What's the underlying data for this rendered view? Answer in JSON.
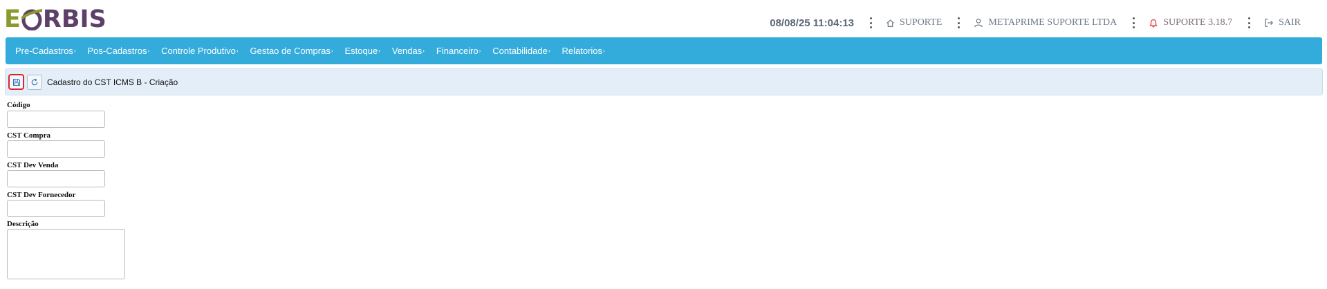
{
  "brand": {
    "logo_e": "E",
    "logo_rbis": "RBIS",
    "primary": "#33acdc",
    "logo_green": "#8a9a2e",
    "logo_purple": "#5d3f6a"
  },
  "header": {
    "datetime": "08/08/25 11:04:13",
    "suporte_label": "SUPORTE",
    "company_label": "METAPRIME SUPORTE LTDA",
    "version_label": "SUPORTE 3.18.7",
    "logout_label": "SAIR",
    "icons": [
      "home-icon",
      "user-icon",
      "bell-icon",
      "logout-icon",
      "kebab-menu-icon"
    ]
  },
  "nav": {
    "items": [
      {
        "label": "Pre-Cadastros"
      },
      {
        "label": "Pos-Cadastros"
      },
      {
        "label": "Controle Produtivo"
      },
      {
        "label": "Gestao de Compras"
      },
      {
        "label": "Estoque"
      },
      {
        "label": "Vendas"
      },
      {
        "label": "Financeiro"
      },
      {
        "label": "Contabilidade"
      },
      {
        "label": "Relatorios"
      }
    ],
    "caret": "›"
  },
  "toolbar": {
    "title": "Cadastro do CST ICMS B - Criação",
    "icons": [
      "save-icon",
      "refresh-icon"
    ]
  },
  "form": {
    "codigo_label": "Código",
    "codigo_value": "",
    "cst_compra_label": "CST Compra",
    "cst_compra_value": "",
    "cst_dev_venda_label": "CST Dev Venda",
    "cst_dev_venda_value": "",
    "cst_dev_fornecedor_label": "CST Dev Fornecedor",
    "cst_dev_fornecedor_value": "",
    "descricao_label": "Descrição",
    "descricao_value": ""
  }
}
